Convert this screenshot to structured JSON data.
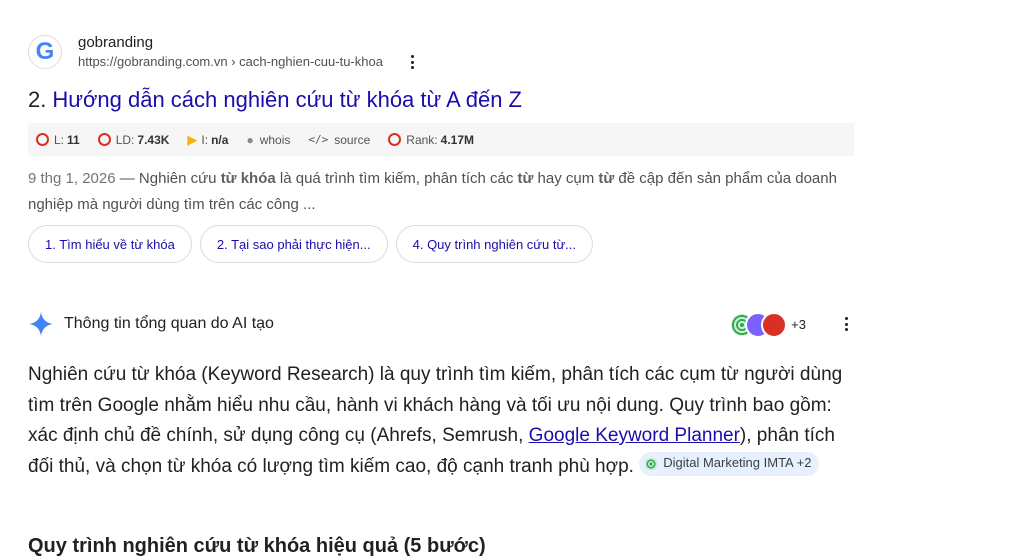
{
  "result": {
    "favicon_letter": "G",
    "site_name": "gobranding",
    "url": "https://gobranding.com.vn › cach-nghien-cuu-tu-khoa",
    "title_number": "2.",
    "title": "Hướng dẫn cách nghiên cứu từ khóa từ A đến Z",
    "seo": {
      "l_label": "L:",
      "l_value": "11",
      "ld_label": "LD:",
      "ld_value": "7.43K",
      "i_label": "I:",
      "i_value": "n/a",
      "whois": "whois",
      "source": "source",
      "rank_label": "Rank:",
      "rank_value": "4.17M"
    },
    "snippet": {
      "date": "9 thg 1, 2026",
      "dash": " — ",
      "t1": "Nghiên cứu ",
      "b1": "từ khóa",
      "t2": " là quá trình tìm kiếm, phân tích các ",
      "b2": "từ",
      "t3": " hay cụm ",
      "b3": "từ",
      "t4": " đề cập đến sản phẩm của doanh nghiệp mà người dùng tìm trên các công ..."
    },
    "chips": [
      "1. Tìm hiểu về từ khóa",
      "2. Tại sao phải thực hiện...",
      "4. Quy trình nghiên cứu từ..."
    ]
  },
  "ai_overview": {
    "title": "Thông tin tổng quan do AI tạo",
    "more_sources": "+3",
    "body_part1": "Nghiên cứu từ khóa (Keyword Research) là quy trình tìm kiếm, phân tích các cụm từ người dùng tìm trên Google nhằm hiểu nhu cầu, hành vi khách hàng và tối ưu nội dung. Quy trình bao gồm: xác định chủ đề chính, sử dụng công cụ (Ahrefs, Semrush, ",
    "link": "Google Keyword Planner",
    "body_part2": "), phân tích đối thủ, và chọn từ khóa có lượng tìm kiếm cao, độ cạnh tranh phù hợp. ",
    "citation": "Digital Marketing IMTA +2",
    "next_heading": "Quy trình nghiên cứu từ khóa hiệu quả (5 bước)"
  },
  "colors": {
    "link_blue": "#1a0dab",
    "ai_spark": "#4285f4",
    "seo_red": "#d93025",
    "bing_yellow": "#f4b400"
  }
}
